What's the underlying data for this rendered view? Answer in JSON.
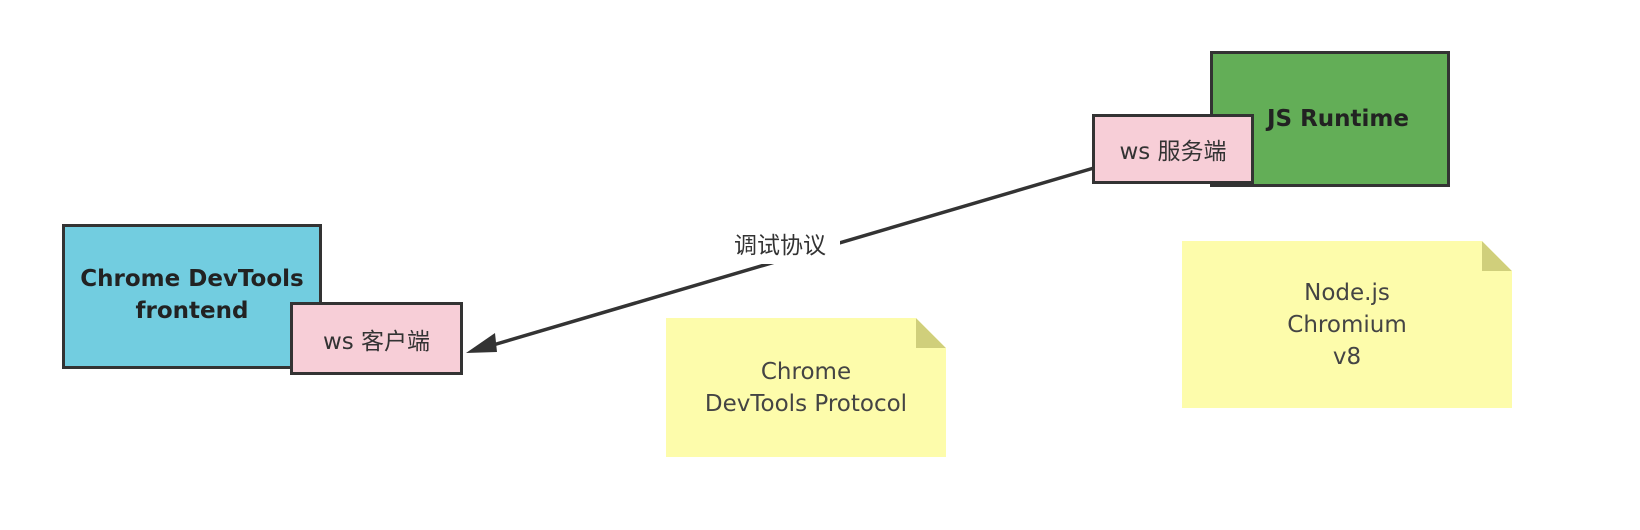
{
  "diagram": {
    "devtools_box": {
      "label": "Chrome DevTools\nfrontend",
      "color": "#72cde0"
    },
    "runtime_box": {
      "label": "JS Runtime",
      "color": "#63ae57"
    },
    "ws_client": {
      "label": "ws 客户端",
      "color": "#f7ced7"
    },
    "ws_server": {
      "label": "ws 服务端",
      "color": "#f7ced7"
    },
    "connector": {
      "label": "调试协议",
      "direction": "bidirectional",
      "stroke": "#333333"
    },
    "note_protocol": {
      "text": "Chrome\nDevTools Protocol",
      "color": "#fdfcab"
    },
    "note_runtimes": {
      "text": "Node.js\nChromium\nv8",
      "color": "#fdfcab"
    }
  }
}
